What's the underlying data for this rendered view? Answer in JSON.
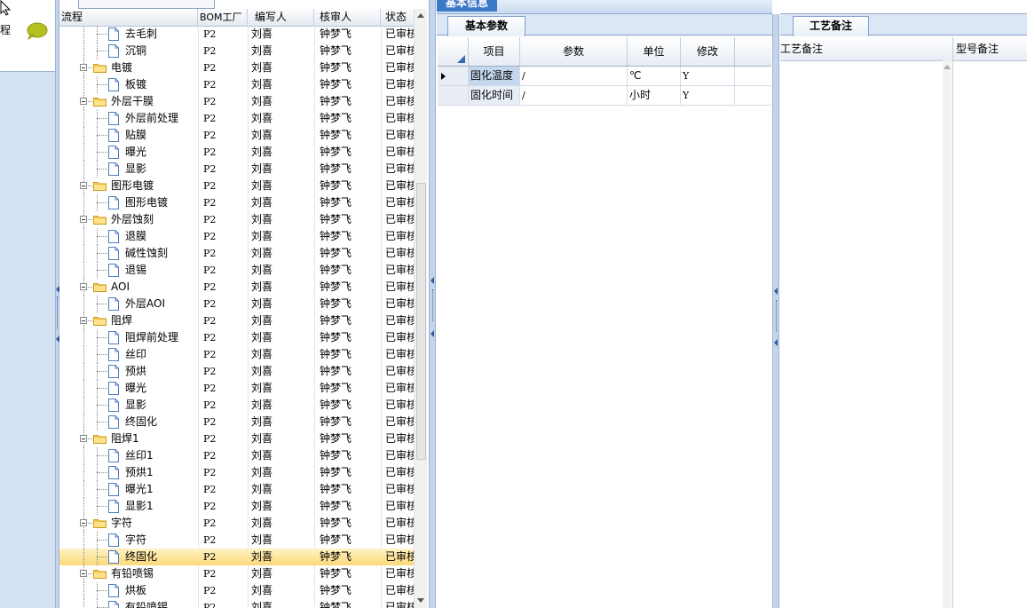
{
  "left_nav": {
    "label": "程"
  },
  "tree": {
    "columns": [
      "流程",
      "BOM工厂",
      "编写人",
      "核审人",
      "状态"
    ],
    "rows": [
      {
        "name": "去毛刺",
        "level": 2,
        "icon": "document-icon",
        "bom": "P2",
        "author": "刘喜",
        "reviewer": "钟梦飞",
        "status": "已审核"
      },
      {
        "name": "沉铜",
        "level": 2,
        "icon": "document-icon",
        "bom": "P2",
        "author": "刘喜",
        "reviewer": "钟梦飞",
        "status": "已审核"
      },
      {
        "name": "电镀",
        "level": 1,
        "icon": "folder-icon",
        "bom": "P2",
        "author": "刘喜",
        "reviewer": "钟梦飞",
        "status": "已审核"
      },
      {
        "name": "板镀",
        "level": 2,
        "icon": "document-icon",
        "bom": "P2",
        "author": "刘喜",
        "reviewer": "钟梦飞",
        "status": "已审核"
      },
      {
        "name": "外层干膜",
        "level": 1,
        "icon": "folder-icon",
        "bom": "P2",
        "author": "刘喜",
        "reviewer": "钟梦飞",
        "status": "已审核"
      },
      {
        "name": "外层前处理",
        "level": 2,
        "icon": "document-icon",
        "bom": "P2",
        "author": "刘喜",
        "reviewer": "钟梦飞",
        "status": "已审核"
      },
      {
        "name": "贴膜",
        "level": 2,
        "icon": "document-icon",
        "bom": "P2",
        "author": "刘喜",
        "reviewer": "钟梦飞",
        "status": "已审核"
      },
      {
        "name": "曝光",
        "level": 2,
        "icon": "document-icon",
        "bom": "P2",
        "author": "刘喜",
        "reviewer": "钟梦飞",
        "status": "已审核"
      },
      {
        "name": "显影",
        "level": 2,
        "icon": "document-icon",
        "bom": "P2",
        "author": "刘喜",
        "reviewer": "钟梦飞",
        "status": "已审核"
      },
      {
        "name": "图形电镀",
        "level": 1,
        "icon": "folder-icon",
        "bom": "P2",
        "author": "刘喜",
        "reviewer": "钟梦飞",
        "status": "已审核"
      },
      {
        "name": "图形电镀",
        "level": 2,
        "icon": "document-icon",
        "bom": "P2",
        "author": "刘喜",
        "reviewer": "钟梦飞",
        "status": "已审核"
      },
      {
        "name": "外层蚀刻",
        "level": 1,
        "icon": "folder-icon",
        "bom": "P2",
        "author": "刘喜",
        "reviewer": "钟梦飞",
        "status": "已审核"
      },
      {
        "name": "退膜",
        "level": 2,
        "icon": "document-icon",
        "bom": "P2",
        "author": "刘喜",
        "reviewer": "钟梦飞",
        "status": "已审核"
      },
      {
        "name": "碱性蚀刻",
        "level": 2,
        "icon": "document-icon",
        "bom": "P2",
        "author": "刘喜",
        "reviewer": "钟梦飞",
        "status": "已审核"
      },
      {
        "name": "退锡",
        "level": 2,
        "icon": "document-icon",
        "bom": "P2",
        "author": "刘喜",
        "reviewer": "钟梦飞",
        "status": "已审核"
      },
      {
        "name": "AOI",
        "level": 1,
        "icon": "folder-icon",
        "bom": "P2",
        "author": "刘喜",
        "reviewer": "钟梦飞",
        "status": "已审核"
      },
      {
        "name": "外层AOI",
        "level": 2,
        "icon": "document-icon",
        "bom": "P2",
        "author": "刘喜",
        "reviewer": "钟梦飞",
        "status": "已审核"
      },
      {
        "name": "阻焊",
        "level": 1,
        "icon": "folder-icon",
        "bom": "P2",
        "author": "刘喜",
        "reviewer": "钟梦飞",
        "status": "已审核"
      },
      {
        "name": "阻焊前处理",
        "level": 2,
        "icon": "document-icon",
        "bom": "P2",
        "author": "刘喜",
        "reviewer": "钟梦飞",
        "status": "已审核"
      },
      {
        "name": "丝印",
        "level": 2,
        "icon": "document-icon",
        "bom": "P2",
        "author": "刘喜",
        "reviewer": "钟梦飞",
        "status": "已审核"
      },
      {
        "name": "预烘",
        "level": 2,
        "icon": "document-icon",
        "bom": "P2",
        "author": "刘喜",
        "reviewer": "钟梦飞",
        "status": "已审核"
      },
      {
        "name": "曝光",
        "level": 2,
        "icon": "document-icon",
        "bom": "P2",
        "author": "刘喜",
        "reviewer": "钟梦飞",
        "status": "已审核"
      },
      {
        "name": "显影",
        "level": 2,
        "icon": "document-icon",
        "bom": "P2",
        "author": "刘喜",
        "reviewer": "钟梦飞",
        "status": "已审核"
      },
      {
        "name": "终固化",
        "level": 2,
        "icon": "document-icon",
        "bom": "P2",
        "author": "刘喜",
        "reviewer": "钟梦飞",
        "status": "已审核"
      },
      {
        "name": "阻焊1",
        "level": 1,
        "icon": "folder-icon",
        "bom": "P2",
        "author": "刘喜",
        "reviewer": "钟梦飞",
        "status": "已审核"
      },
      {
        "name": "丝印1",
        "level": 2,
        "icon": "document-icon",
        "bom": "P2",
        "author": "刘喜",
        "reviewer": "钟梦飞",
        "status": "已审核"
      },
      {
        "name": "预烘1",
        "level": 2,
        "icon": "document-icon",
        "bom": "P2",
        "author": "刘喜",
        "reviewer": "钟梦飞",
        "status": "已审核"
      },
      {
        "name": "曝光1",
        "level": 2,
        "icon": "document-icon",
        "bom": "P2",
        "author": "刘喜",
        "reviewer": "钟梦飞",
        "status": "已审核"
      },
      {
        "name": "显影1",
        "level": 2,
        "icon": "document-icon",
        "bom": "P2",
        "author": "刘喜",
        "reviewer": "钟梦飞",
        "status": "已审核"
      },
      {
        "name": "字符",
        "level": 1,
        "icon": "folder-icon",
        "bom": "P2",
        "author": "刘喜",
        "reviewer": "钟梦飞",
        "status": "已审核"
      },
      {
        "name": "字符",
        "level": 2,
        "icon": "document-icon",
        "bom": "P2",
        "author": "刘喜",
        "reviewer": "钟梦飞",
        "status": "已审核"
      },
      {
        "name": "终固化",
        "level": 2,
        "icon": "document-icon",
        "bom": "P2",
        "author": "刘喜",
        "reviewer": "钟梦飞",
        "status": "已审核",
        "selected": true
      },
      {
        "name": "有铅喷锡",
        "level": 1,
        "icon": "folder-icon",
        "bom": "P2",
        "author": "刘喜",
        "reviewer": "钟梦飞",
        "status": "已审核"
      },
      {
        "name": "烘板",
        "level": 2,
        "icon": "document-icon",
        "bom": "P2",
        "author": "刘喜",
        "reviewer": "钟梦飞",
        "status": "已审核"
      },
      {
        "name": "有铅喷锡",
        "level": 2,
        "icon": "document-icon",
        "bom": "P2",
        "author": "刘喜",
        "reviewer": "钟梦飞",
        "status": "已审核"
      }
    ]
  },
  "middle": {
    "top_tab": "基本信息",
    "tab": "基本参数",
    "columns": [
      "项目",
      "参数",
      "单位",
      "修改"
    ],
    "rows": [
      {
        "item": "固化温度",
        "param": "/",
        "unit": "℃",
        "modify": "Y",
        "selected": true
      },
      {
        "item": "固化时间",
        "param": "/",
        "unit": "小时",
        "modify": "Y"
      }
    ]
  },
  "right": {
    "tab": "工艺备注",
    "columns": [
      "工艺备注",
      "型号备注"
    ]
  },
  "colors": {
    "accent_blue": "#3c78c8",
    "selection_yellow": "#fbd979",
    "panel_blue": "#dce7f5"
  }
}
